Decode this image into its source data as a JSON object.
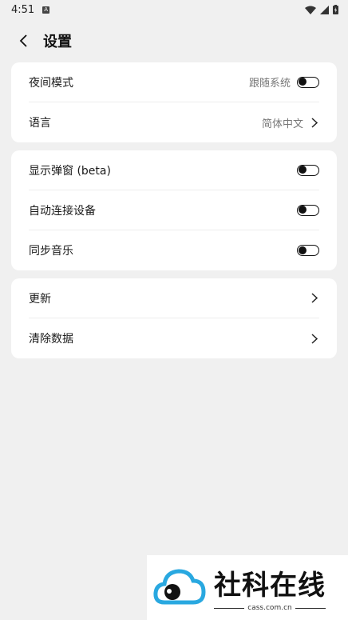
{
  "status": {
    "time": "4:51",
    "notif": "A"
  },
  "header": {
    "title": "设置"
  },
  "groups": [
    {
      "items": [
        {
          "label": "夜间模式",
          "value": "跟随系统",
          "control": "toggle"
        },
        {
          "label": "语言",
          "value": "简体中文",
          "control": "chevron"
        }
      ]
    },
    {
      "items": [
        {
          "label": "显示弹窗 (beta)",
          "control": "toggle"
        },
        {
          "label": "自动连接设备",
          "control": "toggle"
        },
        {
          "label": "同步音乐",
          "control": "toggle"
        }
      ]
    },
    {
      "items": [
        {
          "label": "更新",
          "control": "chevron"
        },
        {
          "label": "清除数据",
          "control": "chevron"
        }
      ]
    }
  ],
  "watermark": {
    "brand": "社科在线",
    "domain": "cass.com.cn"
  },
  "colors": {
    "background": "#f0f0f0",
    "card": "#ffffff",
    "accent": "#29a8e0"
  },
  "icons": [
    "wifi-icon",
    "signal-icon",
    "battery-icon",
    "back-arrow-icon",
    "toggle-icon",
    "chevron-right-icon",
    "cloud-logo-icon"
  ]
}
